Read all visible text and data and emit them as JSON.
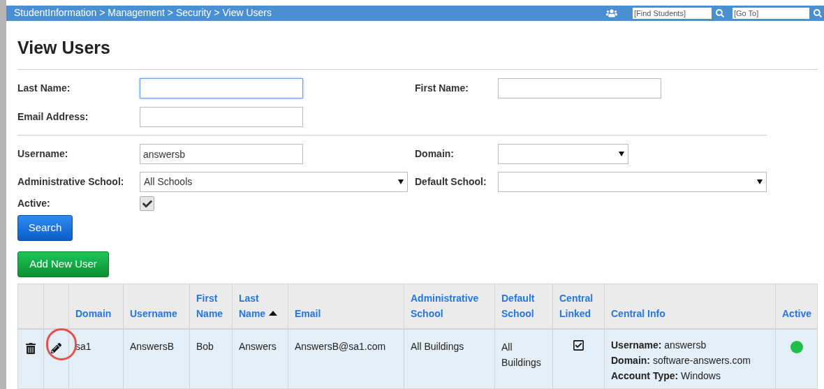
{
  "breadcrumb": "StudentInformation > Management > Security > View Users",
  "topbar": {
    "find_students": {
      "placeholder": "[Find Students]"
    },
    "go_to": {
      "placeholder": "[Go To]"
    }
  },
  "title": "View Users",
  "form": {
    "last_name": {
      "label": "Last Name:",
      "focused": true
    },
    "first_name": {
      "label": "First Name:",
      "focused": false
    },
    "email": {
      "label": "Email Address:",
      "focused": false
    },
    "username": {
      "label": "Username:",
      "value": "answersb",
      "focused": false
    },
    "domain": {
      "label": "Domain:"
    },
    "administrative_school": {
      "label": "Administrative School:",
      "value": "All Schools"
    },
    "default_school": {
      "label": "Default School:"
    },
    "active": {
      "label": "Active:",
      "checked": true
    }
  },
  "buttons": {
    "search": "Search",
    "add_new_user": "Add New User"
  },
  "table": {
    "columns": [
      {
        "label": "Domain",
        "sorted": false
      },
      {
        "label": "Username",
        "sorted": false
      },
      {
        "label": "First Name",
        "sorted": false
      },
      {
        "label": "Last Name",
        "sorted": true
      },
      {
        "label": "Email",
        "sorted": false
      },
      {
        "label": "Administrative School",
        "sorted": false
      },
      {
        "label": "Default School",
        "sorted": false
      },
      {
        "label": "Central Linked",
        "sorted": false
      },
      {
        "label": "Central Info",
        "sorted": false
      },
      {
        "label": "Active",
        "sorted": false
      }
    ],
    "rows": [
      {
        "edit_highlighted": true,
        "domain": "sa1",
        "username": "AnswersB",
        "first_name": "Bob",
        "last_name": "Answers",
        "email": "AnswersB@sa1.com",
        "administrative_school": "All Buildings",
        "default_school": "All Buildings",
        "central_linked": true,
        "central_info": [
          "**Username:** answersb",
          "**Domain:** software-answers.com",
          "**Account Type:** Windows"
        ],
        "active": true
      }
    ]
  }
}
